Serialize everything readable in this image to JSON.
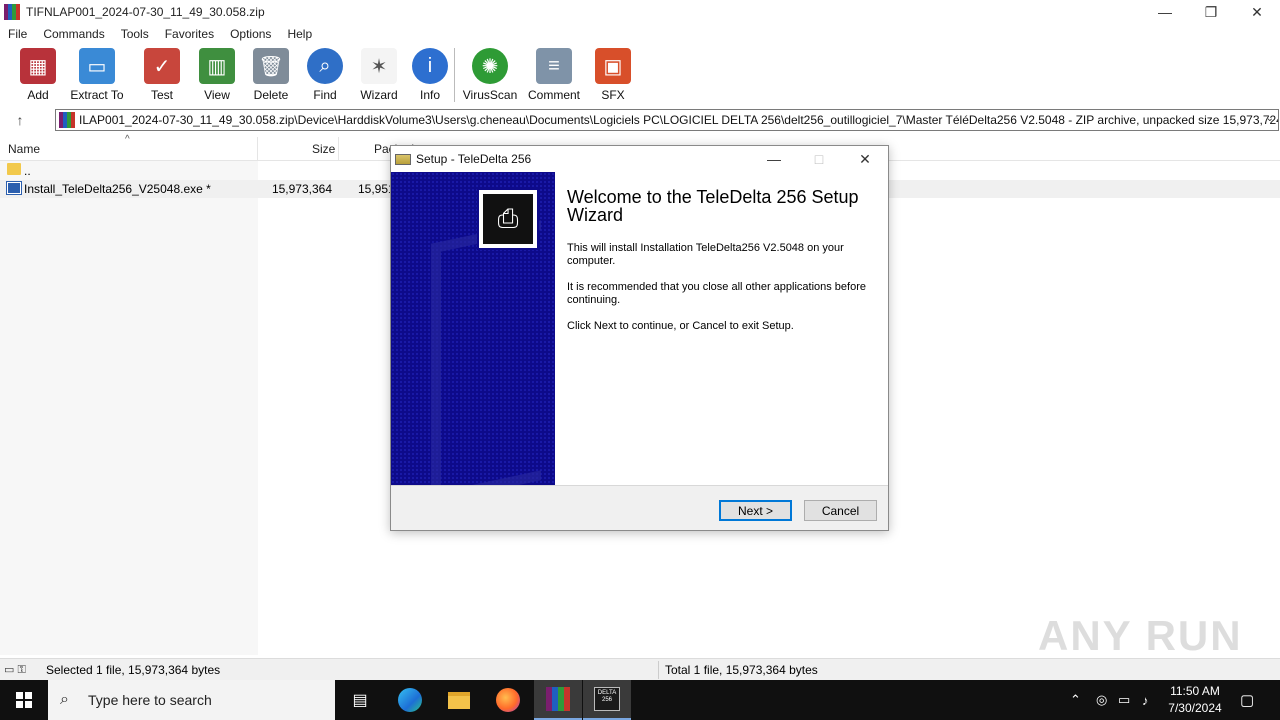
{
  "window": {
    "title": "TIFNLAP001_2024-07-30_11_49_30.058.zip",
    "controls": {
      "minimize": "—",
      "restore": "❐",
      "close": "✕"
    }
  },
  "menu": [
    "File",
    "Commands",
    "Tools",
    "Favorites",
    "Options",
    "Help"
  ],
  "toolbar": [
    {
      "label": "Add",
      "icon": "add-archive-icon",
      "color": "#b8323a"
    },
    {
      "label": "Extract To",
      "icon": "extract-folder-icon",
      "color": "#3a8ad6"
    },
    {
      "label": "Test",
      "icon": "test-clipboard-icon",
      "color": "#c8463c"
    },
    {
      "label": "View",
      "icon": "view-book-icon",
      "color": "#3f8f3f"
    },
    {
      "label": "Delete",
      "icon": "trash-icon",
      "color": "#7f8c99"
    },
    {
      "label": "Find",
      "icon": "magnifier-icon",
      "color": "#2f6fc7"
    },
    {
      "label": "Wizard",
      "icon": "magic-wand-icon",
      "color": "#444444"
    },
    {
      "label": "Info",
      "icon": "info-icon",
      "color": "#2d6fd0"
    },
    {
      "label": "VirusScan",
      "icon": "virus-scan-icon",
      "color": "#2e9b35"
    },
    {
      "label": "Comment",
      "icon": "comment-icon",
      "color": "#7f93a8"
    },
    {
      "label": "SFX",
      "icon": "sfx-box-icon",
      "color": "#d84f2a"
    }
  ],
  "address": {
    "path": "ILAP001_2024-07-30_11_49_30.058.zip\\Device\\HarddiskVolume3\\Users\\g.cheneau\\Documents\\Logiciels PC\\LOGICIEL DELTA 256\\delt256_outillogiciel_7\\Master TéléDelta256 V2.5048 - ZIP archive, unpacked size 15,973,724 bytes"
  },
  "columns": {
    "name": "Name",
    "size": "Size",
    "packed": "Packed"
  },
  "files": [
    {
      "name": "..",
      "size": "",
      "packed": ""
    },
    {
      "name": "Install_TeleDelta256_V25048.exe *",
      "size": "15,973,364",
      "packed": "15,951"
    }
  ],
  "status": {
    "left": "Selected 1 file, 15,973,364 bytes",
    "right": "Total 1 file, 15,973,364 bytes"
  },
  "watermark": "ANY RUN",
  "dialog": {
    "title": "Setup - TeleDelta 256",
    "heading": "Welcome to the TeleDelta 256 Setup Wizard",
    "p1": "This will install Installation TeleDelta256 V2.5048 on your computer.",
    "p2": "It is recommended that you close all other applications before continuing.",
    "p3": "Click Next to continue, or Cancel to exit Setup.",
    "next": "Next >",
    "cancel": "Cancel"
  },
  "taskbar": {
    "search_placeholder": "Type here to search",
    "time": "11:50 AM",
    "date": "7/30/2024",
    "pinned": [
      "task-view-icon",
      "edge-icon",
      "file-explorer-icon",
      "firefox-icon",
      "winrar-icon",
      "teledelta-icon"
    ]
  }
}
